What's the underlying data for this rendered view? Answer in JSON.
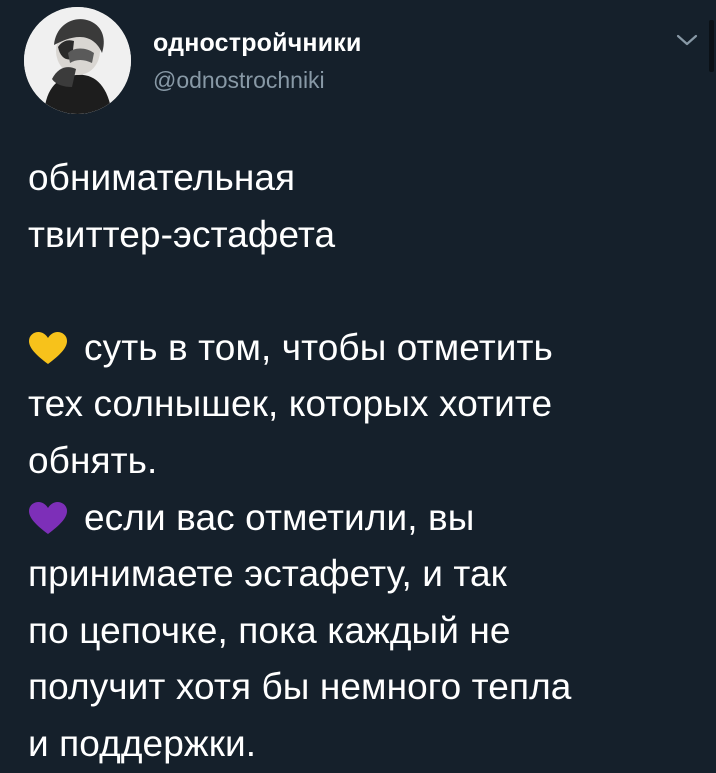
{
  "account": {
    "display_name": "одностройчники",
    "handle": "@odnostrochniki",
    "avatar_icon": "avatar-photo"
  },
  "menu": {
    "icon": "chevron-down-icon"
  },
  "tweet": {
    "title_lines": [
      "обнимательная",
      "твиттер-эстафета"
    ],
    "paragraph1": {
      "emoji": "yellow-heart",
      "emoji_color": "#f7c21b",
      "lines": [
        "суть в том, чтобы отметить",
        "тех солнышек, которых хотите",
        "обнять."
      ]
    },
    "paragraph2": {
      "emoji": "purple-heart",
      "emoji_color": "#7d2fb8",
      "lines": [
        "если вас отметили, вы",
        "принимаете эстафету, и так",
        "по цепочке, пока каждый не",
        "получит хотя бы немного тепла",
        "и поддержки."
      ]
    }
  },
  "colors": {
    "background": "#15202b",
    "text": "#ffffff",
    "secondary_text": "#8899a6"
  }
}
